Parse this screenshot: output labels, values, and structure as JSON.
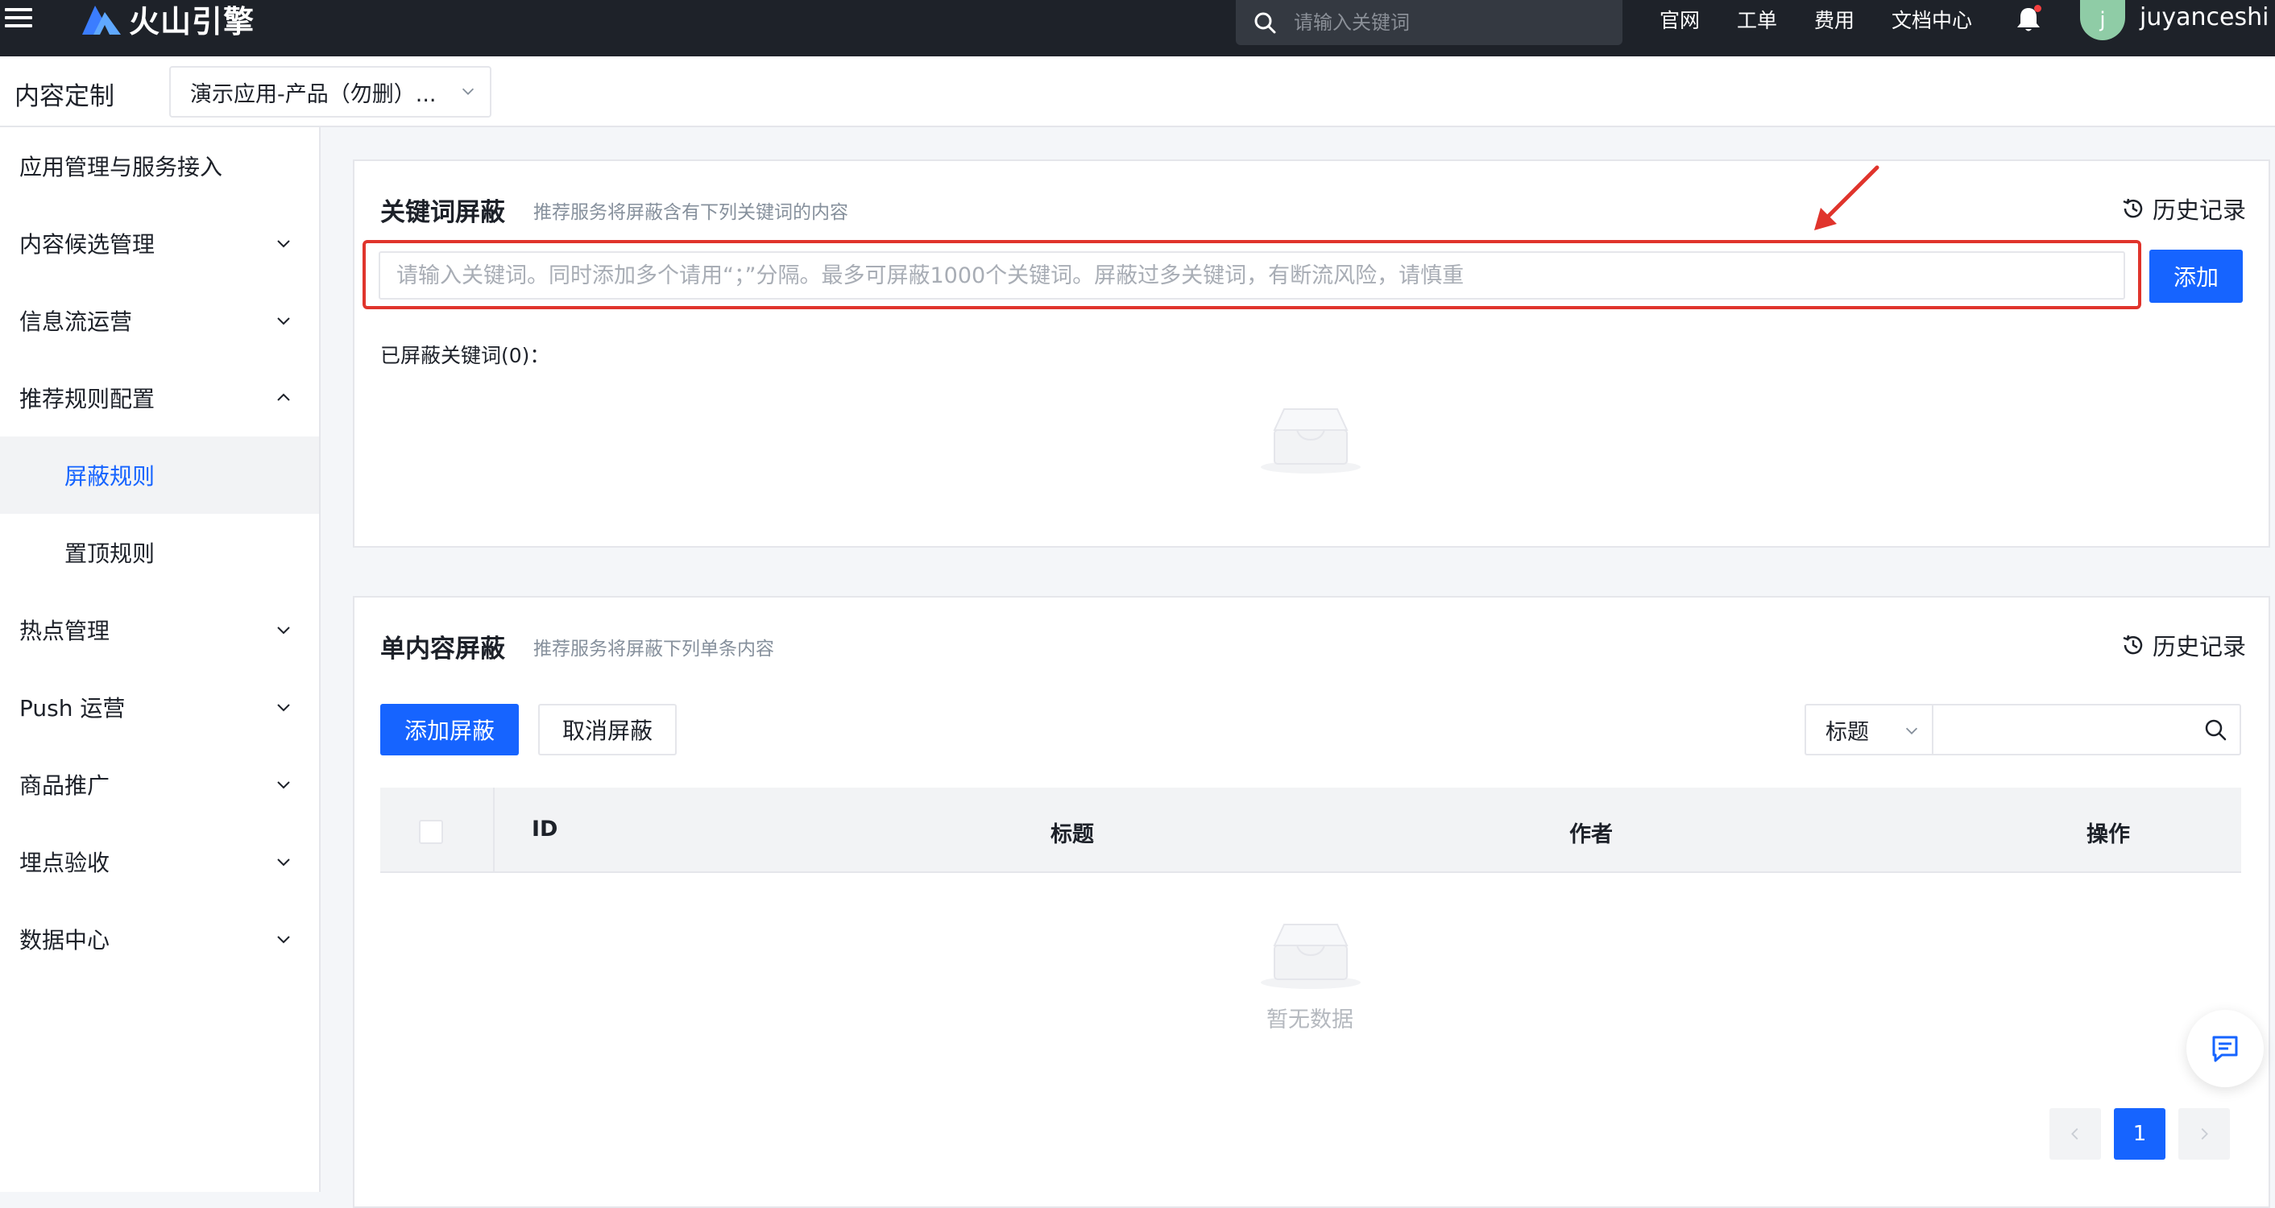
{
  "topbar": {
    "brand": "火山引擎",
    "search_placeholder": "请输入关键词",
    "links": [
      "官网",
      "工单",
      "费用",
      "文档中心"
    ],
    "avatar_letter": "j",
    "username": "juyanceshi"
  },
  "subheader": {
    "title": "内容定制",
    "app_selected": "演示应用-产品（勿删）..."
  },
  "sidebar": {
    "items": [
      {
        "label": "应用管理与服务接入"
      },
      {
        "label": "内容候选管理",
        "chevron": "down"
      },
      {
        "label": "信息流运营",
        "chevron": "down"
      },
      {
        "label": "推荐规则配置",
        "chevron": "up"
      },
      {
        "label": "屏蔽规则",
        "active": true
      },
      {
        "label": "置顶规则"
      },
      {
        "label": "热点管理",
        "chevron": "down"
      },
      {
        "label": "Push 运营",
        "chevron": "down"
      },
      {
        "label": "商品推广",
        "chevron": "down"
      },
      {
        "label": "埋点验收",
        "chevron": "down"
      },
      {
        "label": "数据中心",
        "chevron": "down"
      }
    ]
  },
  "keyword_block": {
    "title": "关键词屏蔽",
    "subtitle": "推荐服务将屏蔽含有下列关键词的内容",
    "history_label": "历史记录",
    "input_placeholder": "请输入关键词。同时添加多个请用“；”分隔。最多可屏蔽1000个关键词。屏蔽过多关键词，有断流风险，请慎重",
    "add_label": "添加",
    "blocked_label": "已屏蔽关键词(0)："
  },
  "content_block": {
    "title": "单内容屏蔽",
    "subtitle": "推荐服务将屏蔽下列单条内容",
    "history_label": "历史记录",
    "add_block_label": "添加屏蔽",
    "cancel_block_label": "取消屏蔽",
    "filter_field": "标题",
    "columns": [
      "ID",
      "标题",
      "作者",
      "操作"
    ],
    "empty_text": "暂无数据"
  },
  "pagination": {
    "current_page": "1"
  },
  "colors": {
    "primary": "#1664ff",
    "highlight": "#e0342c",
    "topbar": "#1e2229"
  }
}
